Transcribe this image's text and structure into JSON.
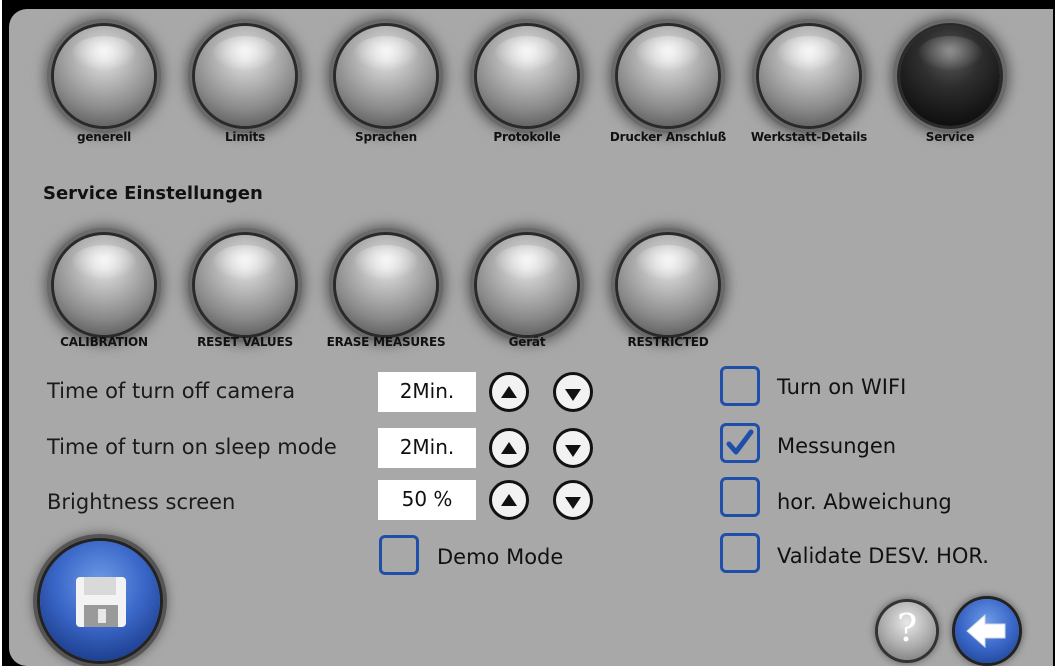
{
  "tabs": [
    {
      "label": "generell"
    },
    {
      "label": "Limits"
    },
    {
      "label": "Sprachen"
    },
    {
      "label": "Protokolle"
    },
    {
      "label": "Drucker Anschluß"
    },
    {
      "label": "Werkstatt-Details"
    },
    {
      "label": "Service",
      "active": true
    }
  ],
  "section_title": "Service Einstellungen",
  "service_buttons": [
    {
      "label": "CALIBRATION"
    },
    {
      "label": "RESET VALUES"
    },
    {
      "label": "ERASE MEASURES"
    },
    {
      "label": "Gerät"
    },
    {
      "label": "RESTRICTED"
    }
  ],
  "settings": [
    {
      "label": "Time of turn off camera",
      "value": "2Min."
    },
    {
      "label": "Time of turn on sleep mode",
      "value": "2Min."
    },
    {
      "label": "Brightness screen",
      "value": "50 %"
    }
  ],
  "demo_mode": {
    "label": "Demo Mode",
    "checked": false
  },
  "options": [
    {
      "label": "Turn on WIFI",
      "checked": false
    },
    {
      "label": "Messungen",
      "checked": true
    },
    {
      "label": "hor. Abweichung",
      "checked": false
    },
    {
      "label": "Validate DESV. HOR.",
      "checked": false
    }
  ],
  "icons": {
    "save": "floppy-disk-icon",
    "help": "question-mark-icon",
    "back": "back-arrow-icon",
    "help_glyph": "?"
  },
  "colors": {
    "panel": "#a8a8a8",
    "checkbox_border": "#1f4fa8",
    "accent_blue": "#3a67c8"
  }
}
